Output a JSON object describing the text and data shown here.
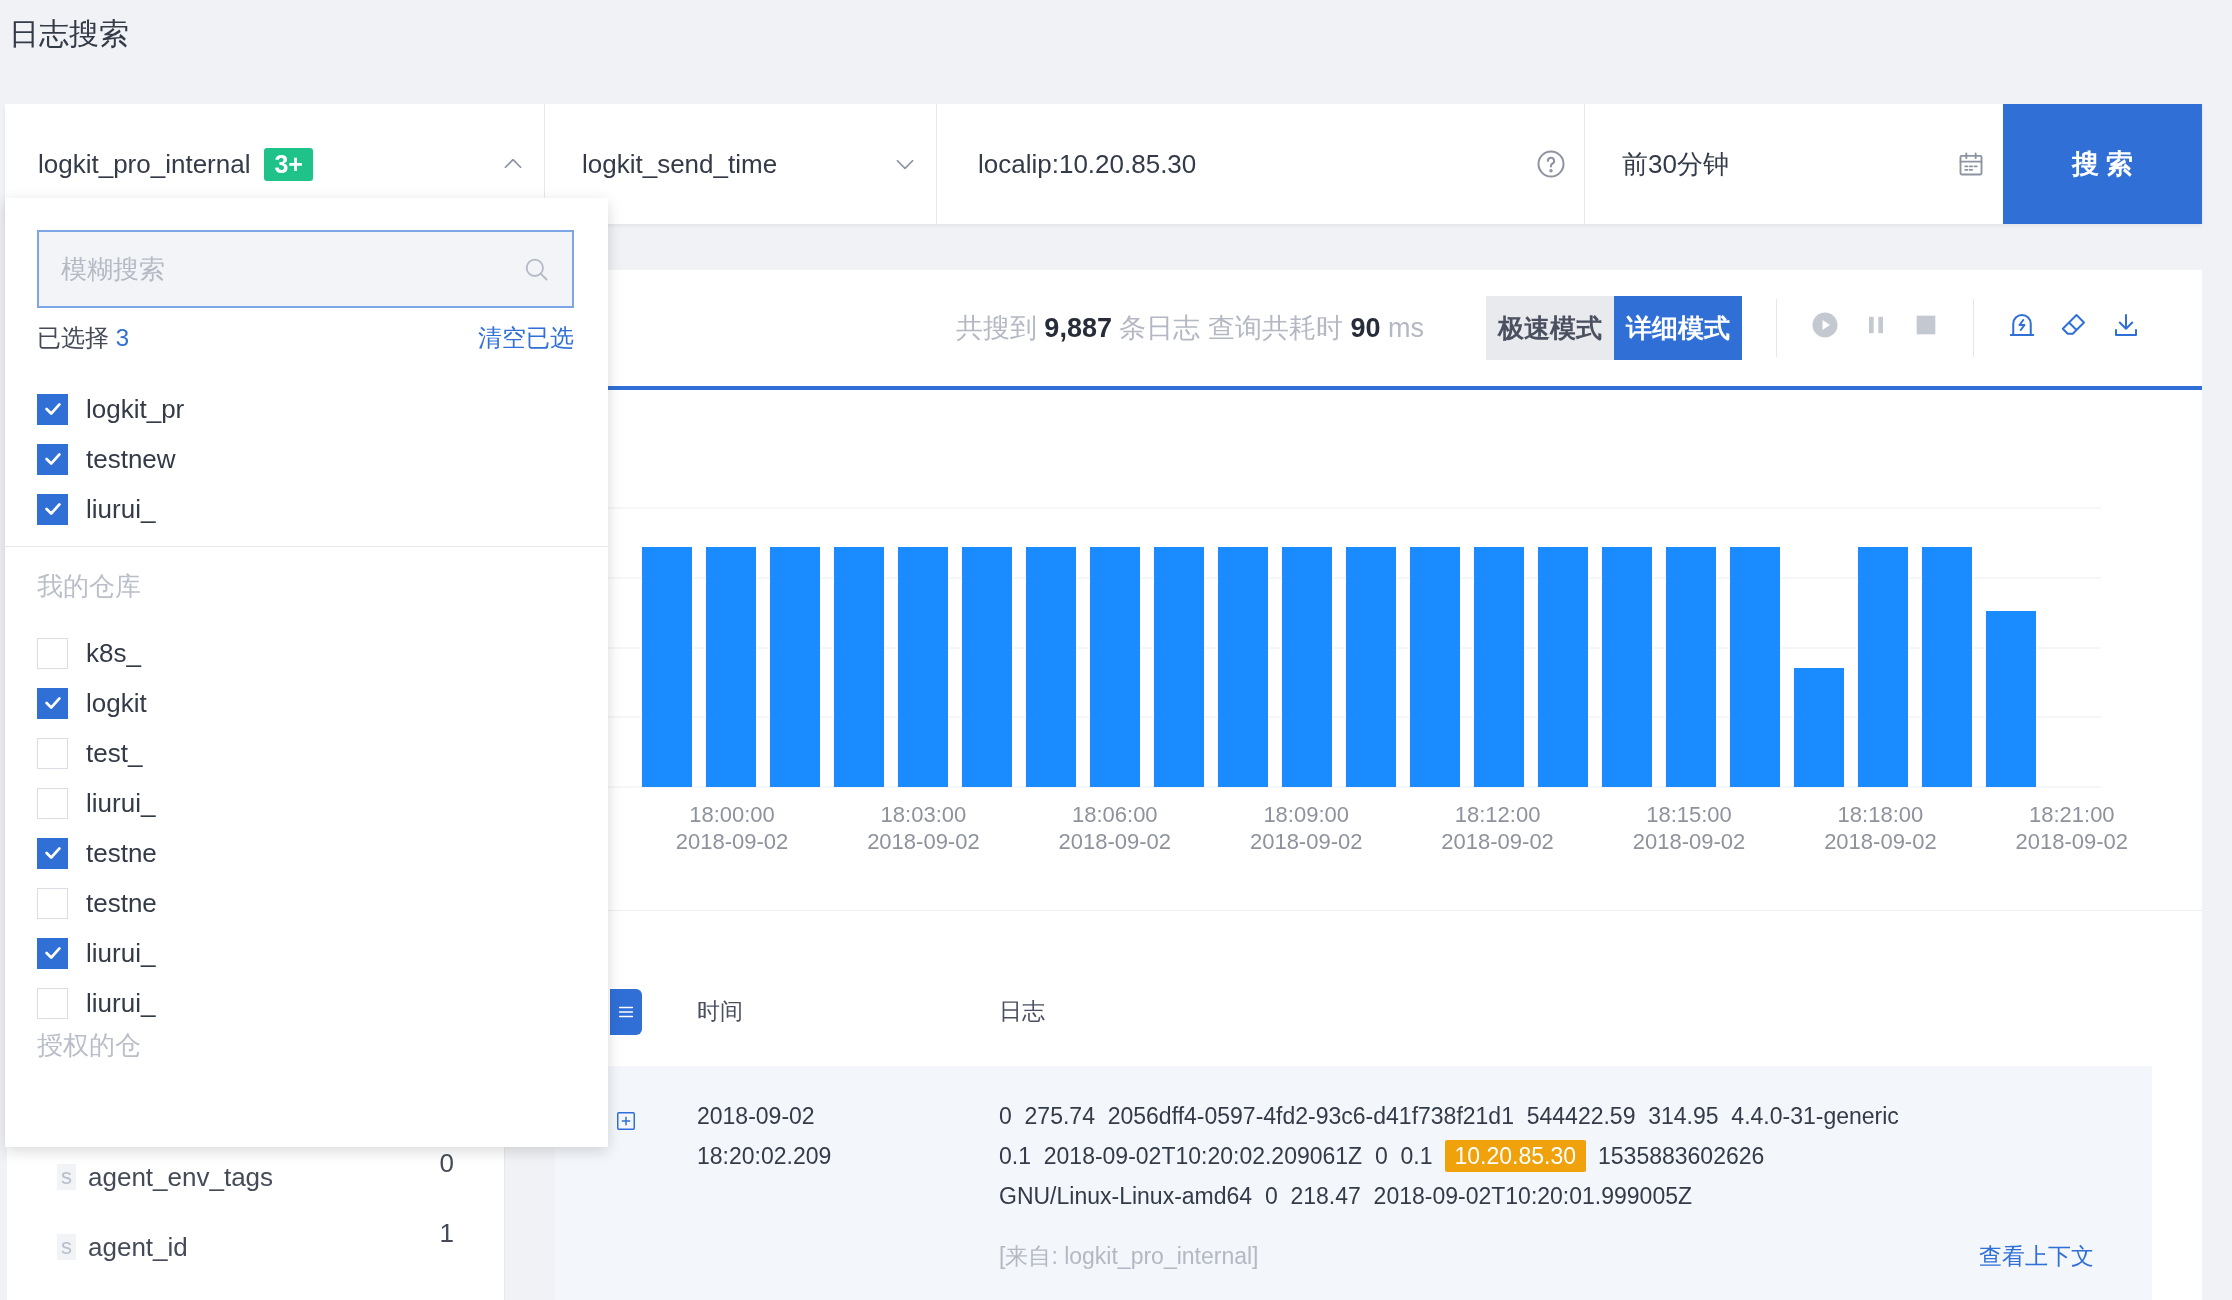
{
  "page_title": "日志搜索",
  "search_bar": {
    "repo_select": {
      "value": "logkit_pro_internal",
      "badge": "3+",
      "expanded": true
    },
    "field_select": {
      "value": "logkit_send_time"
    },
    "query": {
      "value": "localip:10.20.85.30"
    },
    "time_range": {
      "value": "前30分钟"
    },
    "search_button": "搜 索"
  },
  "repo_dropdown": {
    "search": {
      "placeholder": "模糊搜索"
    },
    "selected_label": "已选择",
    "selected_count": "3",
    "clear_link": "清空已选",
    "selected_items": [
      {
        "label": "logkit_pr",
        "checked": true
      },
      {
        "label": "testnew",
        "checked": true
      },
      {
        "label": "liurui_",
        "checked": true
      }
    ],
    "groups": [
      {
        "title": "我的仓库",
        "items": [
          {
            "label": "k8s_",
            "checked": false
          },
          {
            "label": "logkit",
            "checked": true
          },
          {
            "label": "test_",
            "checked": false
          },
          {
            "label": "liurui_",
            "checked": false
          },
          {
            "label": "testne",
            "checked": true
          },
          {
            "label": "testne",
            "checked": false
          },
          {
            "label": "liurui_",
            "checked": true
          },
          {
            "label": "liurui_",
            "checked": false
          }
        ]
      },
      {
        "title": "授权的仓"
      }
    ]
  },
  "fields_sidebar": {
    "fields": [
      {
        "type_tag": "s",
        "name": "agent_env_tags",
        "count": "0"
      },
      {
        "type_tag": "s",
        "name": "agent_id",
        "count": "1"
      }
    ]
  },
  "results": {
    "summary": {
      "prefix": "共搜到",
      "count": "9,887",
      "middle": "条日志 查询共耗时",
      "time": "90",
      "unit": "ms"
    },
    "modes": [
      {
        "label": "极速模式",
        "selected": false
      },
      {
        "label": "详细模式",
        "selected": true
      }
    ],
    "chart": {
      "axis_labels": [
        {
          "time": "18:00:00",
          "date": "2018-09-02"
        },
        {
          "time": "18:03:00",
          "date": "2018-09-02"
        },
        {
          "time": "18:06:00",
          "date": "2018-09-02"
        },
        {
          "time": "18:09:00",
          "date": "2018-09-02"
        },
        {
          "time": "18:12:00",
          "date": "2018-09-02"
        },
        {
          "time": "18:15:00",
          "date": "2018-09-02"
        },
        {
          "time": "18:18:00",
          "date": "2018-09-02"
        },
        {
          "time": "18:21:00",
          "date": "2018-09-02"
        }
      ]
    },
    "table": {
      "columns": [
        "时间",
        "日志"
      ],
      "rows": [
        {
          "date": "2018-09-02",
          "clock": "18:20:02.209",
          "log_lines": [
            [
              {
                "text": "0  275.74  2056dff4-0597-4fd2-93c6-d41f738f21d1  544422.59  314.95  4.4.0-31-generic",
                "highlight": false
              }
            ],
            [
              {
                "text": "0.1  2018-09-02T10:20:02.209061Z  0  0.1",
                "highlight": false
              },
              {
                "text": "10.20.85.30",
                "highlight": true
              },
              {
                "text": "1535883602626",
                "highlight": false
              }
            ],
            [
              {
                "text": "GNU/Linux-Linux-amd64  0  218.47  2018-09-02T10:20:01.999005Z",
                "highlight": false
              }
            ]
          ],
          "source": "[来自: logkit_pro_internal]",
          "context_link": "查看上下文"
        }
      ]
    }
  }
}
